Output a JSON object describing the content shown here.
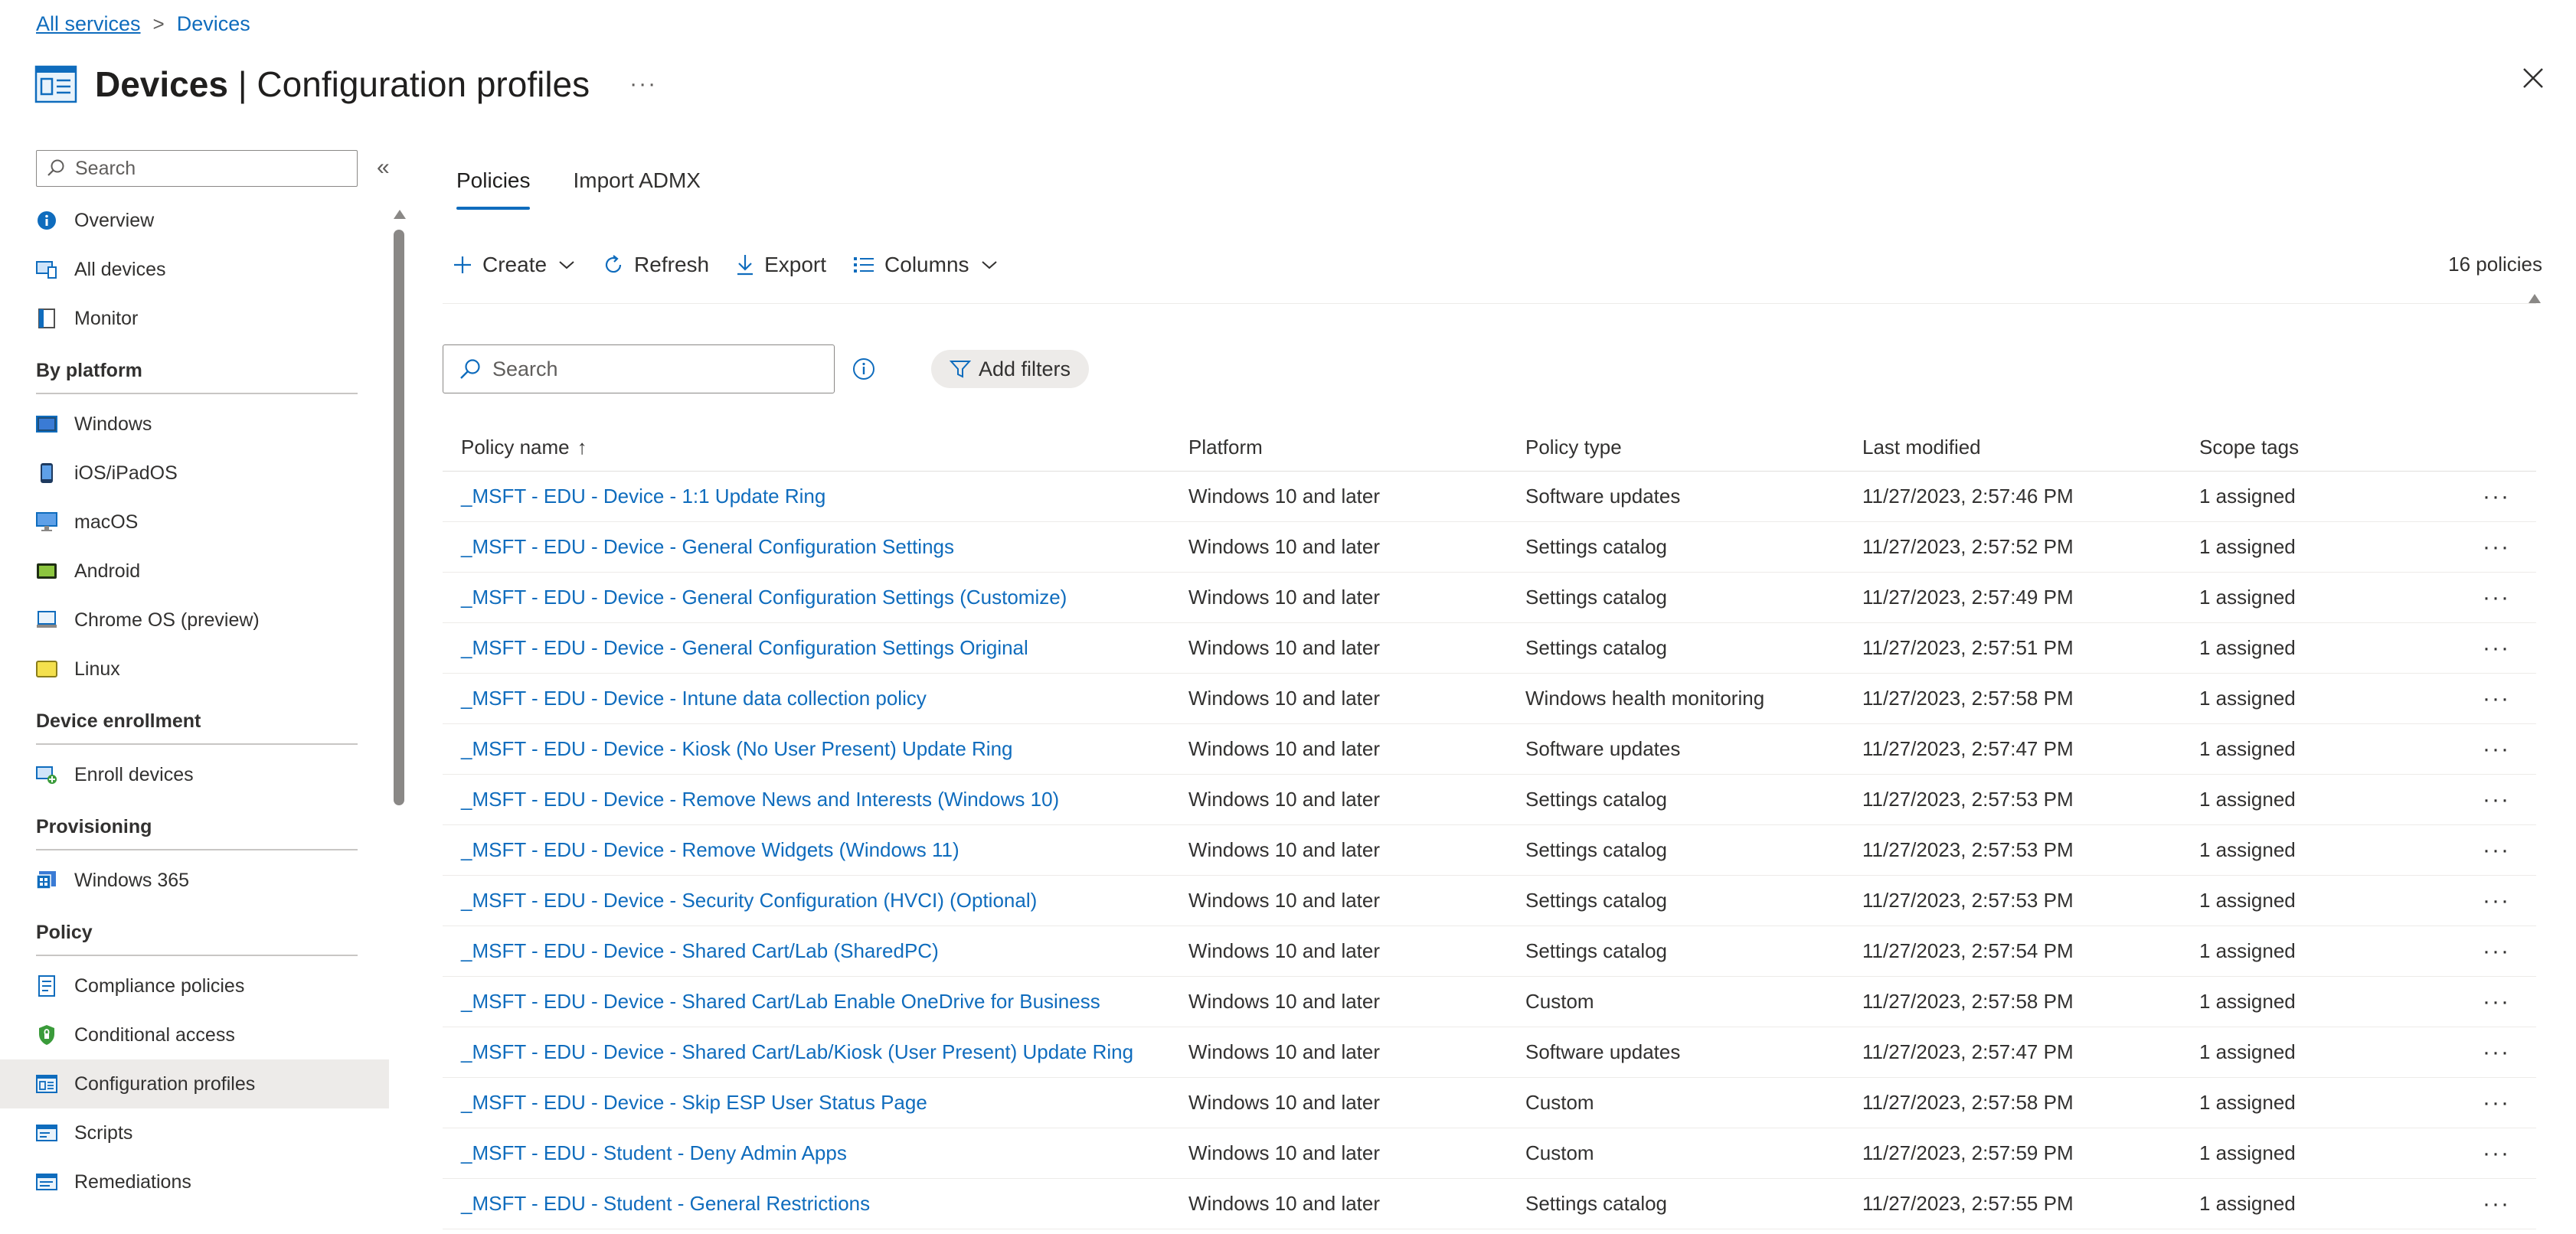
{
  "breadcrumb": {
    "root": "All services",
    "current": "Devices"
  },
  "header": {
    "title_bold": "Devices",
    "title_rest": " | Configuration profiles",
    "more": "···"
  },
  "nav": {
    "search_placeholder": "Search",
    "collapse": "«",
    "items_top": [
      {
        "label": "Overview",
        "icon": "info-icon"
      },
      {
        "label": "All devices",
        "icon": "devices-icon"
      },
      {
        "label": "Monitor",
        "icon": "monitor-icon"
      }
    ],
    "groups": [
      {
        "label": "By platform",
        "items": [
          {
            "label": "Windows",
            "icon": "windows-icon"
          },
          {
            "label": "iOS/iPadOS",
            "icon": "phone-icon"
          },
          {
            "label": "macOS",
            "icon": "mac-icon"
          },
          {
            "label": "Android",
            "icon": "android-icon"
          },
          {
            "label": "Chrome OS (preview)",
            "icon": "chrome-os-icon"
          },
          {
            "label": "Linux",
            "icon": "linux-icon"
          }
        ]
      },
      {
        "label": "Device enrollment",
        "items": [
          {
            "label": "Enroll devices",
            "icon": "enroll-icon"
          }
        ]
      },
      {
        "label": "Provisioning",
        "items": [
          {
            "label": "Windows 365",
            "icon": "windows365-icon"
          }
        ]
      },
      {
        "label": "Policy",
        "items": [
          {
            "label": "Compliance policies",
            "icon": "compliance-icon"
          },
          {
            "label": "Conditional access",
            "icon": "shield-icon"
          },
          {
            "label": "Configuration profiles",
            "icon": "config-profile-icon",
            "active": true
          },
          {
            "label": "Scripts",
            "icon": "scripts-icon"
          },
          {
            "label": "Remediations",
            "icon": "remediations-icon"
          }
        ]
      }
    ]
  },
  "tabs": [
    {
      "label": "Policies",
      "active": true
    },
    {
      "label": "Import ADMX",
      "active": false
    }
  ],
  "toolbar": {
    "create": "Create",
    "refresh": "Refresh",
    "export": "Export",
    "columns": "Columns",
    "count": "16 policies"
  },
  "search": {
    "placeholder": "Search",
    "add_filters": "Add filters"
  },
  "table": {
    "headers": {
      "name": "Policy name",
      "name_sort": "↑",
      "platform": "Platform",
      "type": "Policy type",
      "modified": "Last modified",
      "scope": "Scope tags"
    },
    "rows": [
      {
        "name": "_MSFT - EDU - Device - 1:1 Update Ring",
        "platform": "Windows 10 and later",
        "type": "Software updates",
        "modified": "11/27/2023, 2:57:46 PM",
        "scope": "1 assigned"
      },
      {
        "name": "_MSFT - EDU - Device - General Configuration Settings",
        "platform": "Windows 10 and later",
        "type": "Settings catalog",
        "modified": "11/27/2023, 2:57:52 PM",
        "scope": "1 assigned"
      },
      {
        "name": "_MSFT - EDU - Device - General Configuration Settings (Customize)",
        "platform": "Windows 10 and later",
        "type": "Settings catalog",
        "modified": "11/27/2023, 2:57:49 PM",
        "scope": "1 assigned"
      },
      {
        "name": "_MSFT - EDU - Device - General Configuration Settings Original",
        "platform": "Windows 10 and later",
        "type": "Settings catalog",
        "modified": "11/27/2023, 2:57:51 PM",
        "scope": "1 assigned"
      },
      {
        "name": "_MSFT - EDU - Device - Intune data collection policy",
        "platform": "Windows 10 and later",
        "type": "Windows health monitoring",
        "modified": "11/27/2023, 2:57:58 PM",
        "scope": "1 assigned"
      },
      {
        "name": "_MSFT - EDU - Device - Kiosk (No User Present) Update Ring",
        "platform": "Windows 10 and later",
        "type": "Software updates",
        "modified": "11/27/2023, 2:57:47 PM",
        "scope": "1 assigned"
      },
      {
        "name": "_MSFT - EDU - Device - Remove News and Interests (Windows 10)",
        "platform": "Windows 10 and later",
        "type": "Settings catalog",
        "modified": "11/27/2023, 2:57:53 PM",
        "scope": "1 assigned"
      },
      {
        "name": "_MSFT - EDU - Device - Remove Widgets (Windows 11)",
        "platform": "Windows 10 and later",
        "type": "Settings catalog",
        "modified": "11/27/2023, 2:57:53 PM",
        "scope": "1 assigned"
      },
      {
        "name": "_MSFT - EDU - Device - Security Configuration (HVCI) (Optional)",
        "platform": "Windows 10 and later",
        "type": "Settings catalog",
        "modified": "11/27/2023, 2:57:53 PM",
        "scope": "1 assigned"
      },
      {
        "name": "_MSFT - EDU - Device - Shared Cart/Lab (SharedPC)",
        "platform": "Windows 10 and later",
        "type": "Settings catalog",
        "modified": "11/27/2023, 2:57:54 PM",
        "scope": "1 assigned"
      },
      {
        "name": "_MSFT - EDU - Device - Shared Cart/Lab Enable OneDrive for Business",
        "platform": "Windows 10 and later",
        "type": "Custom",
        "modified": "11/27/2023, 2:57:58 PM",
        "scope": "1 assigned"
      },
      {
        "name": "_MSFT - EDU - Device - Shared Cart/Lab/Kiosk (User Present) Update Ring",
        "platform": "Windows 10 and later",
        "type": "Software updates",
        "modified": "11/27/2023, 2:57:47 PM",
        "scope": "1 assigned"
      },
      {
        "name": "_MSFT - EDU - Device - Skip ESP User Status Page",
        "platform": "Windows 10 and later",
        "type": "Custom",
        "modified": "11/27/2023, 2:57:58 PM",
        "scope": "1 assigned"
      },
      {
        "name": "_MSFT - EDU - Student - Deny Admin Apps",
        "platform": "Windows 10 and later",
        "type": "Custom",
        "modified": "11/27/2023, 2:57:59 PM",
        "scope": "1 assigned"
      },
      {
        "name": "_MSFT - EDU - Student - General Restrictions",
        "platform": "Windows 10 and later",
        "type": "Settings catalog",
        "modified": "11/27/2023, 2:57:55 PM",
        "scope": "1 assigned"
      }
    ],
    "row_action": "···"
  },
  "colors": {
    "accent": "#0f6cbd",
    "text": "#323130",
    "active_bg": "#edebe9"
  }
}
